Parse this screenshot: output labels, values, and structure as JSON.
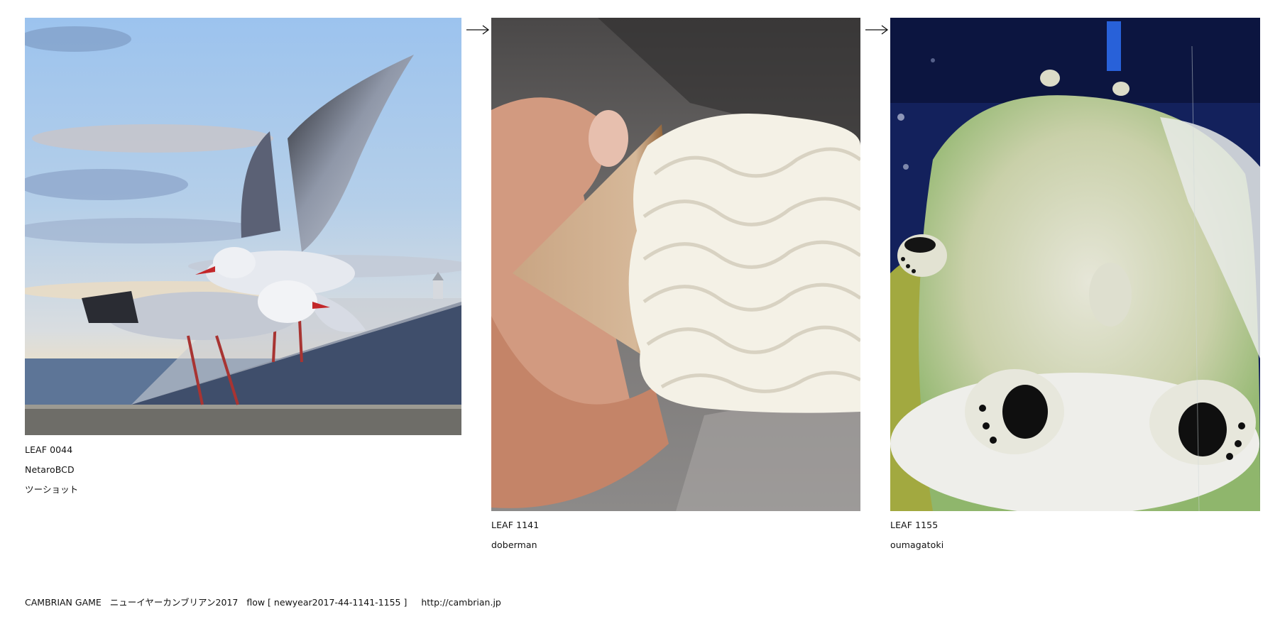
{
  "leaves": [
    {
      "id": "LEAF 0044",
      "author": "NetaroBCD",
      "title": "ツーショット",
      "image": "two-seagulls-on-roof-photo"
    },
    {
      "id": "LEAF 1141",
      "author": "doberman",
      "image": "soft-serve-cone-in-hand-photo"
    },
    {
      "id": "LEAF 1155",
      "author": "oumagatoki",
      "image": "polar-bear-underwater-photo"
    }
  ],
  "arrows": [
    "arrow-right-icon",
    "arrow-right-icon"
  ],
  "footer": {
    "brand": "CAMBRIAN GAME",
    "event": "ニューイヤーカンブリアン2017",
    "flow": "flow [ newyear2017-44-1141-1155 ]",
    "url": "http://cambrian.jp"
  },
  "colors": {
    "sky": "#a9c8ea",
    "roof": "#3f4e6b",
    "cream": "#f4f1e6",
    "bear": "#d9dcc4",
    "water": "#13215c"
  }
}
